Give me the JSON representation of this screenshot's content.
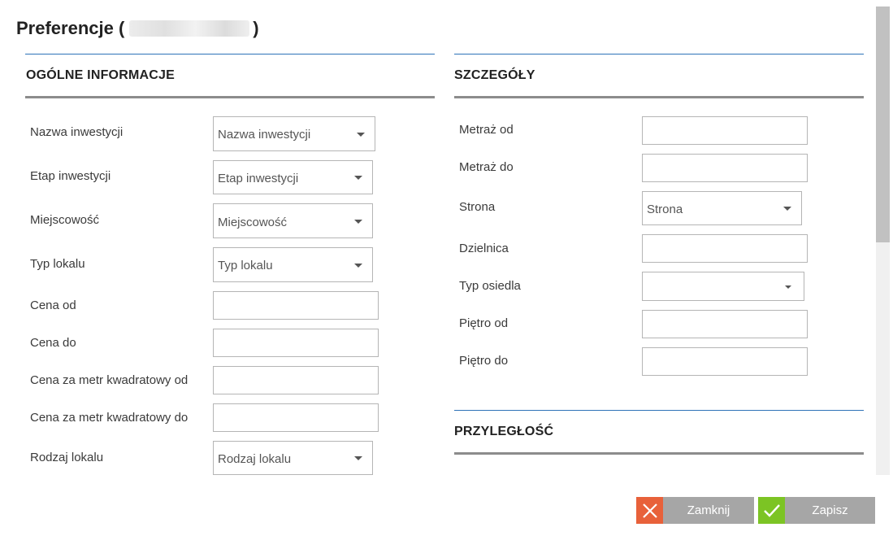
{
  "dialog": {
    "title_prefix": "Preferencje (",
    "title_suffix": ")"
  },
  "left_section": {
    "heading": "OGÓLNE INFORMACJE",
    "fields": [
      {
        "label": "Nazwa inwestycji",
        "placeholder": "Nazwa inwestycji",
        "type": "select"
      },
      {
        "label": "Etap inwestycji",
        "placeholder": "Etap inwestycji",
        "type": "select"
      },
      {
        "label": "Miejscowość",
        "placeholder": "Miejscowość",
        "type": "select"
      },
      {
        "label": "Typ lokalu",
        "placeholder": "Typ lokalu",
        "type": "select"
      },
      {
        "label": "Cena od",
        "value": "",
        "type": "text"
      },
      {
        "label": "Cena do",
        "value": "",
        "type": "text"
      },
      {
        "label": "Cena za metr kwadratowy od",
        "value": "",
        "type": "text"
      },
      {
        "label": "Cena za metr kwadratowy do",
        "value": "",
        "type": "text"
      },
      {
        "label": "Rodzaj lokalu",
        "placeholder": "Rodzaj lokalu",
        "type": "select"
      }
    ]
  },
  "right_section": {
    "heading": "SZCZEGÓŁY",
    "fields": [
      {
        "label": "Metraż od",
        "value": "",
        "type": "text"
      },
      {
        "label": "Metraż do",
        "value": "",
        "type": "text"
      },
      {
        "label": "Strona",
        "placeholder": "Strona",
        "type": "select"
      },
      {
        "label": "Dzielnica",
        "value": "",
        "type": "text"
      },
      {
        "label": "Typ osiedla",
        "placeholder": "",
        "type": "select"
      },
      {
        "label": "Piętro od",
        "value": "",
        "type": "text"
      },
      {
        "label": "Piętro do",
        "value": "",
        "type": "text"
      }
    ]
  },
  "adjacency_section": {
    "heading": "PRZYLEGŁOŚĆ"
  },
  "buttons": {
    "close_label": "Zamknij",
    "save_label": "Zapisz"
  },
  "icons": {
    "close": "close-icon",
    "save": "check-icon",
    "dropdown": "caret-down-icon"
  },
  "colors": {
    "section_rule": "#2e73b8",
    "close_accent": "#e8613a",
    "save_accent": "#7cc424",
    "button_bg": "#a6a6a6"
  }
}
